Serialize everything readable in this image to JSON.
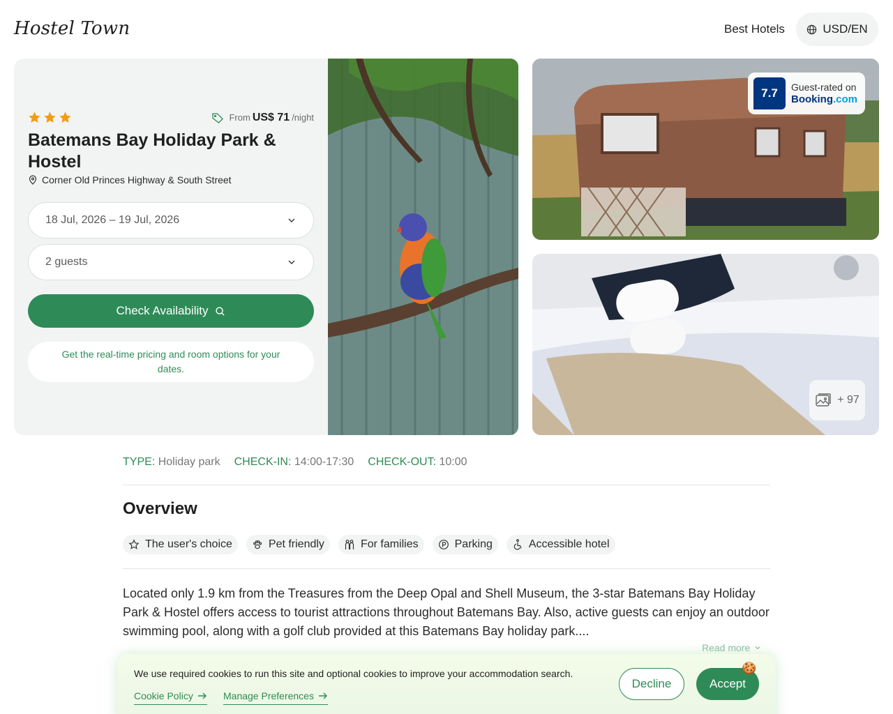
{
  "header": {
    "logo": "Hostel Town",
    "nav_best_hotels": "Best Hotels",
    "currency_label": "USD/EN",
    "currency_icon": "globe-icon"
  },
  "hotel": {
    "star_count": 3,
    "star_color": "#f39c12",
    "price_prefix": "From",
    "price_amount": "US$ 71",
    "price_suffix": "/night",
    "name": "Batemans Bay Holiday Park & Hostel",
    "address": "Corner Old Princes Highway & South Street"
  },
  "booking": {
    "dates_value": "18 Jul, 2026 – 19 Jul, 2026",
    "guests_value": "2 guests",
    "check_button": "Check Availability",
    "note": "Get the real-time pricing and room options for your dates."
  },
  "rating": {
    "score": "7.7",
    "line1": "Guest-rated on",
    "brand_main": "Booking",
    "brand_suffix": ".com"
  },
  "gallery": {
    "more_count": "+ 97"
  },
  "info": {
    "type_key": "TYPE:",
    "type_value": "Holiday park",
    "checkin_key": "CHECK-IN:",
    "checkin_value": "14:00-17:30",
    "checkout_key": "CHECK-OUT:",
    "checkout_value": "10:00"
  },
  "overview": {
    "title": "Overview",
    "chips": [
      {
        "label": "The user's choice",
        "icon": "star-outline-icon"
      },
      {
        "label": "Pet friendly",
        "icon": "paw-icon"
      },
      {
        "label": "For families",
        "icon": "family-icon"
      },
      {
        "label": "Parking",
        "icon": "parking-icon"
      },
      {
        "label": "Accessible hotel",
        "icon": "wheelchair-icon"
      }
    ],
    "description": "Located only 1.9 km from the Treasures from the Deep Opal and Shell Museum, the 3-star Batemans Bay Holiday Park & Hostel offers access to tourist attractions throughout Batemans Bay. Also, active guests can enjoy an outdoor swimming pool, along with a golf club provided at this Batemans Bay holiday park....",
    "read_more": "Read more"
  },
  "cookie": {
    "text": "We use required cookies to run this site and optional cookies to improve your accommodation search.",
    "policy_link": "Cookie Policy",
    "manage_link": "Manage Preferences",
    "decline": "Decline",
    "accept": "Accept",
    "emoji": "🍪"
  },
  "colors": {
    "brand_green": "#2e8b57",
    "booking_blue": "#003580"
  }
}
